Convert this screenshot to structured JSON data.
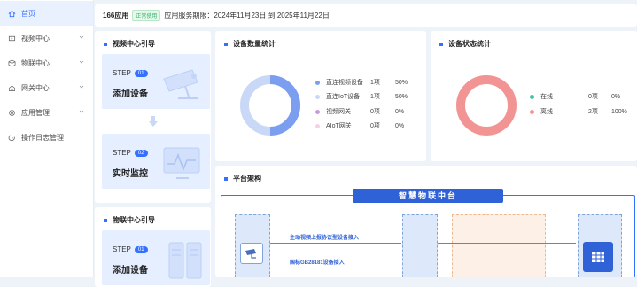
{
  "sidebar": {
    "items": [
      {
        "label": "首页",
        "icon": "home-icon"
      },
      {
        "label": "视频中心",
        "icon": "video-icon"
      },
      {
        "label": "物联中心",
        "icon": "iot-cube-icon"
      },
      {
        "label": "网关中心",
        "icon": "gateway-icon"
      },
      {
        "label": "应用管理",
        "icon": "gear-icon"
      },
      {
        "label": "操作日志管理",
        "icon": "log-icon"
      }
    ]
  },
  "topbar": {
    "app_name": "166应用",
    "status": "正常使用",
    "period": "应用服务期限：2024年11月23日 到 2025年11月22日"
  },
  "video_guide": {
    "title": "视频中心引导",
    "steps": [
      {
        "label": "STEP",
        "num": "01",
        "title": "添加设备"
      },
      {
        "label": "STEP",
        "num": "02",
        "title": "实时监控"
      }
    ]
  },
  "iot_guide": {
    "title": "物联中心引导",
    "steps": [
      {
        "label": "STEP",
        "num": "01",
        "title": "添加设备"
      }
    ]
  },
  "device_count": {
    "title": "设备数量统计",
    "rows": [
      {
        "name": "直连视频设备",
        "count": "1项",
        "pct": "50%",
        "color": "#7b9ef0"
      },
      {
        "name": "直连IoT设备",
        "count": "1项",
        "pct": "50%",
        "color": "#c9d8f7"
      },
      {
        "name": "视频网关",
        "count": "0项",
        "pct": "0%",
        "color": "#c59be0"
      },
      {
        "name": "AIoT网关",
        "count": "0项",
        "pct": "0%",
        "color": "#f2d3e6"
      }
    ]
  },
  "device_status": {
    "title": "设备状态统计",
    "rows": [
      {
        "name": "在线",
        "count": "0项",
        "pct": "0%",
        "color": "#41c39a"
      },
      {
        "name": "离线",
        "count": "2项",
        "pct": "100%",
        "color": "#f29494"
      }
    ]
  },
  "platform": {
    "title": "平台架构",
    "header": "智慧物联中台",
    "flow1": "主动视频上报协议型设备接入",
    "flow2": "国标GB28181设备接入"
  },
  "colors": {
    "accent": "#3370ff",
    "accent_dark": "#2f62d6"
  }
}
